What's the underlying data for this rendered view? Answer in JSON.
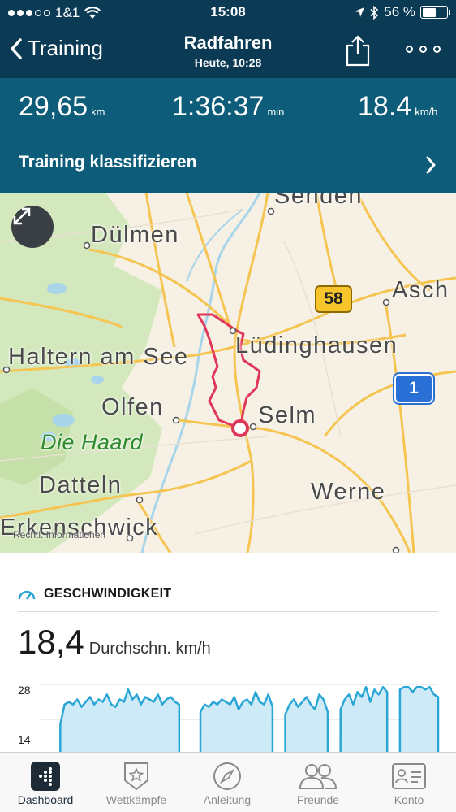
{
  "status_bar": {
    "carrier": "1&1",
    "time": "15:08",
    "battery_text": "56 %",
    "battery_level": 0.56
  },
  "nav": {
    "back_label": "Training",
    "title": "Radfahren",
    "subtitle": "Heute, 10:28"
  },
  "stats": [
    {
      "value": "29,65",
      "unit": "km"
    },
    {
      "value": "1:36:37",
      "unit": "min"
    },
    {
      "value": "18.4",
      "unit": "km/h"
    }
  ],
  "classify_label": "Training klassifizieren",
  "map": {
    "labels": {
      "senden": "Senden",
      "duelmen": "Dülmen",
      "asch": "Asch",
      "haltern": "Haltern am See",
      "luedinghausen": "Lüdinghausen",
      "olfen": "Olfen",
      "selm": "Selm",
      "haard": "Die Haard",
      "datteln": "Datteln",
      "werne": "Werne",
      "erkenschwick": "Erkenschwick"
    },
    "shield_58": "58",
    "shield_1": "1",
    "footer": "Rechtl. Informationen",
    "colors": {
      "route": "#e0365a",
      "road": "#f5c451",
      "water": "#a8d5ea",
      "forest": "#cfe6b7"
    }
  },
  "speed": {
    "heading": "GESCHWINDIGKEIT",
    "value": "18,4",
    "unit_label": "Durchschn. km/h",
    "accent": "#2aa6d6"
  },
  "chart_data": {
    "type": "area",
    "y_ticks": [
      "28",
      "14"
    ],
    "ylim": [
      0,
      30
    ],
    "series": [
      {
        "values": [
          0,
          0,
          0,
          0,
          0,
          0,
          0,
          0,
          0,
          0,
          12,
          20,
          21,
          20,
          22,
          19,
          21,
          23,
          20,
          22,
          21,
          24,
          20,
          19,
          22,
          21,
          26,
          22,
          24,
          20,
          23,
          22,
          21,
          24,
          20,
          22,
          23,
          21,
          20,
          0,
          0,
          0,
          0,
          17,
          20,
          19,
          21,
          20,
          22,
          21,
          20,
          23,
          18,
          21,
          22,
          20,
          25,
          21,
          20,
          24,
          19,
          0,
          0,
          16,
          20,
          22,
          19,
          21,
          23,
          20,
          18,
          24,
          22,
          17,
          0,
          0,
          18,
          22,
          24,
          20,
          25,
          23,
          27,
          21,
          26,
          24,
          27,
          25,
          0,
          0,
          26,
          27,
          27,
          25,
          27,
          27,
          26,
          27,
          24,
          23
        ]
      }
    ]
  },
  "tabs": [
    {
      "label": "Dashboard",
      "icon": "dashboard-icon"
    },
    {
      "label": "Wettkämpfe",
      "icon": "star-badge-icon"
    },
    {
      "label": "Anleitung",
      "icon": "compass-icon"
    },
    {
      "label": "Freunde",
      "icon": "friends-icon"
    },
    {
      "label": "Konto",
      "icon": "account-card-icon"
    }
  ]
}
